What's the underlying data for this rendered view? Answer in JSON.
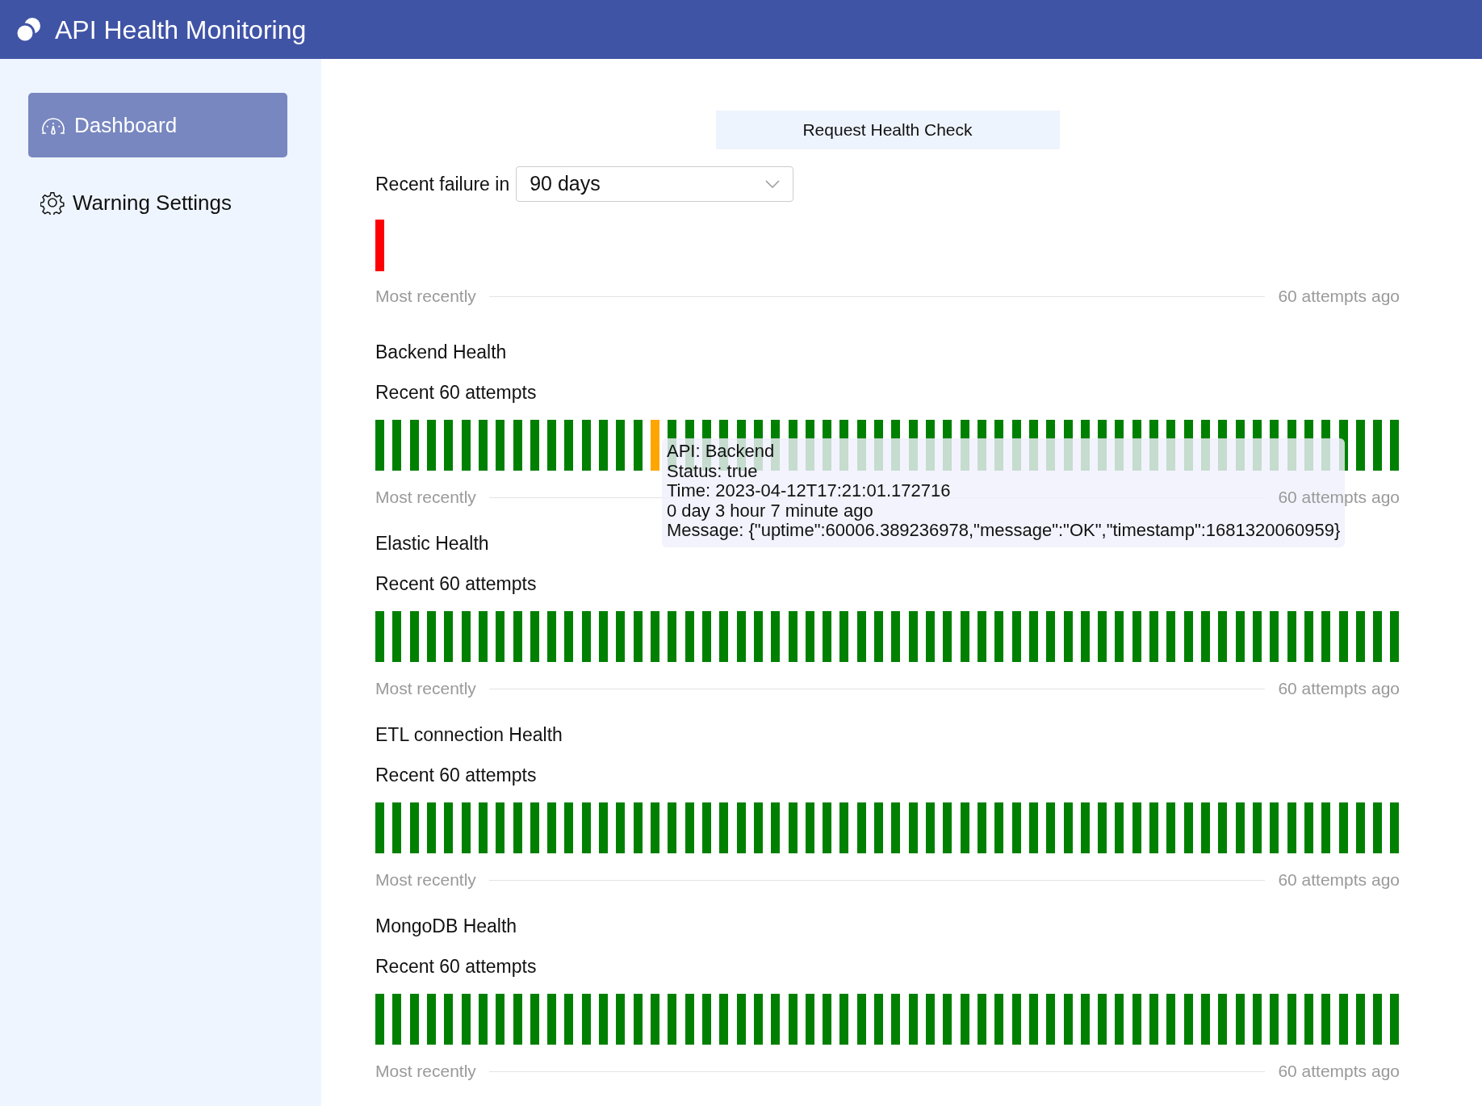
{
  "app": {
    "title": "API Health Monitoring"
  },
  "sidebar": {
    "items": [
      {
        "label": "Dashboard",
        "selected": true
      },
      {
        "label": "Warning Settings",
        "selected": false
      }
    ]
  },
  "toolbar": {
    "button": "Request Health Check"
  },
  "failure_filter": {
    "label": "Recent failure in",
    "value": "90 days"
  },
  "recent_failures": {
    "attempts": [
      {
        "color": "#ff0000"
      }
    ],
    "axis_start": "Most recently",
    "axis_end": "60 attempts ago"
  },
  "sections": [
    {
      "title": "Backend Health",
      "subtitle": "Recent 60 attempts",
      "attempts": [
        {
          "color": "#008000"
        },
        {
          "color": "#008000"
        },
        {
          "color": "#008000"
        },
        {
          "color": "#008000"
        },
        {
          "color": "#008000"
        },
        {
          "color": "#008000"
        },
        {
          "color": "#008000"
        },
        {
          "color": "#008000"
        },
        {
          "color": "#008000"
        },
        {
          "color": "#008000"
        },
        {
          "color": "#008000"
        },
        {
          "color": "#008000"
        },
        {
          "color": "#008000"
        },
        {
          "color": "#008000"
        },
        {
          "color": "#008000"
        },
        {
          "color": "#008000"
        },
        {
          "color": "#ffa500"
        },
        {
          "color": "#008000"
        },
        {
          "color": "#008000"
        },
        {
          "color": "#008000"
        },
        {
          "color": "#008000"
        },
        {
          "color": "#008000"
        },
        {
          "color": "#008000"
        },
        {
          "color": "#008000"
        },
        {
          "color": "#008000"
        },
        {
          "color": "#008000"
        },
        {
          "color": "#008000"
        },
        {
          "color": "#008000"
        },
        {
          "color": "#008000"
        },
        {
          "color": "#008000"
        },
        {
          "color": "#008000"
        },
        {
          "color": "#008000"
        },
        {
          "color": "#008000"
        },
        {
          "color": "#008000"
        },
        {
          "color": "#008000"
        },
        {
          "color": "#008000"
        },
        {
          "color": "#008000"
        },
        {
          "color": "#008000"
        },
        {
          "color": "#008000"
        },
        {
          "color": "#008000"
        },
        {
          "color": "#008000"
        },
        {
          "color": "#008000"
        },
        {
          "color": "#008000"
        },
        {
          "color": "#008000"
        },
        {
          "color": "#008000"
        },
        {
          "color": "#008000"
        },
        {
          "color": "#008000"
        },
        {
          "color": "#008000"
        },
        {
          "color": "#008000"
        },
        {
          "color": "#008000"
        },
        {
          "color": "#008000"
        },
        {
          "color": "#008000"
        },
        {
          "color": "#008000"
        },
        {
          "color": "#008000"
        },
        {
          "color": "#008000"
        },
        {
          "color": "#008000"
        },
        {
          "color": "#008000"
        },
        {
          "color": "#008000"
        },
        {
          "color": "#008000"
        },
        {
          "color": "#008000"
        }
      ],
      "axis_start": "Most recently",
      "axis_end": "60 attempts ago",
      "tooltip": {
        "lines": [
          "API: Backend",
          "Status: true",
          "Time: 2023-04-12T17:21:01.172716",
          "0 day 3 hour 7 minute ago",
          "Message: {\"uptime\":60006.389236978,\"message\":\"OK\",\"timestamp\":1681320060959}"
        ]
      }
    },
    {
      "title": "Elastic Health",
      "subtitle": "Recent 60 attempts",
      "attempts": [
        {
          "color": "#008000"
        },
        {
          "color": "#008000"
        },
        {
          "color": "#008000"
        },
        {
          "color": "#008000"
        },
        {
          "color": "#008000"
        },
        {
          "color": "#008000"
        },
        {
          "color": "#008000"
        },
        {
          "color": "#008000"
        },
        {
          "color": "#008000"
        },
        {
          "color": "#008000"
        },
        {
          "color": "#008000"
        },
        {
          "color": "#008000"
        },
        {
          "color": "#008000"
        },
        {
          "color": "#008000"
        },
        {
          "color": "#008000"
        },
        {
          "color": "#008000"
        },
        {
          "color": "#008000"
        },
        {
          "color": "#008000"
        },
        {
          "color": "#008000"
        },
        {
          "color": "#008000"
        },
        {
          "color": "#008000"
        },
        {
          "color": "#008000"
        },
        {
          "color": "#008000"
        },
        {
          "color": "#008000"
        },
        {
          "color": "#008000"
        },
        {
          "color": "#008000"
        },
        {
          "color": "#008000"
        },
        {
          "color": "#008000"
        },
        {
          "color": "#008000"
        },
        {
          "color": "#008000"
        },
        {
          "color": "#008000"
        },
        {
          "color": "#008000"
        },
        {
          "color": "#008000"
        },
        {
          "color": "#008000"
        },
        {
          "color": "#008000"
        },
        {
          "color": "#008000"
        },
        {
          "color": "#008000"
        },
        {
          "color": "#008000"
        },
        {
          "color": "#008000"
        },
        {
          "color": "#008000"
        },
        {
          "color": "#008000"
        },
        {
          "color": "#008000"
        },
        {
          "color": "#008000"
        },
        {
          "color": "#008000"
        },
        {
          "color": "#008000"
        },
        {
          "color": "#008000"
        },
        {
          "color": "#008000"
        },
        {
          "color": "#008000"
        },
        {
          "color": "#008000"
        },
        {
          "color": "#008000"
        },
        {
          "color": "#008000"
        },
        {
          "color": "#008000"
        },
        {
          "color": "#008000"
        },
        {
          "color": "#008000"
        },
        {
          "color": "#008000"
        },
        {
          "color": "#008000"
        },
        {
          "color": "#008000"
        },
        {
          "color": "#008000"
        },
        {
          "color": "#008000"
        },
        {
          "color": "#008000"
        }
      ],
      "axis_start": "Most recently",
      "axis_end": "60 attempts ago"
    },
    {
      "title": "ETL connection Health",
      "subtitle": "Recent 60 attempts",
      "attempts": [
        {
          "color": "#008000"
        },
        {
          "color": "#008000"
        },
        {
          "color": "#008000"
        },
        {
          "color": "#008000"
        },
        {
          "color": "#008000"
        },
        {
          "color": "#008000"
        },
        {
          "color": "#008000"
        },
        {
          "color": "#008000"
        },
        {
          "color": "#008000"
        },
        {
          "color": "#008000"
        },
        {
          "color": "#008000"
        },
        {
          "color": "#008000"
        },
        {
          "color": "#008000"
        },
        {
          "color": "#008000"
        },
        {
          "color": "#008000"
        },
        {
          "color": "#008000"
        },
        {
          "color": "#008000"
        },
        {
          "color": "#008000"
        },
        {
          "color": "#008000"
        },
        {
          "color": "#008000"
        },
        {
          "color": "#008000"
        },
        {
          "color": "#008000"
        },
        {
          "color": "#008000"
        },
        {
          "color": "#008000"
        },
        {
          "color": "#008000"
        },
        {
          "color": "#008000"
        },
        {
          "color": "#008000"
        },
        {
          "color": "#008000"
        },
        {
          "color": "#008000"
        },
        {
          "color": "#008000"
        },
        {
          "color": "#008000"
        },
        {
          "color": "#008000"
        },
        {
          "color": "#008000"
        },
        {
          "color": "#008000"
        },
        {
          "color": "#008000"
        },
        {
          "color": "#008000"
        },
        {
          "color": "#008000"
        },
        {
          "color": "#008000"
        },
        {
          "color": "#008000"
        },
        {
          "color": "#008000"
        },
        {
          "color": "#008000"
        },
        {
          "color": "#008000"
        },
        {
          "color": "#008000"
        },
        {
          "color": "#008000"
        },
        {
          "color": "#008000"
        },
        {
          "color": "#008000"
        },
        {
          "color": "#008000"
        },
        {
          "color": "#008000"
        },
        {
          "color": "#008000"
        },
        {
          "color": "#008000"
        },
        {
          "color": "#008000"
        },
        {
          "color": "#008000"
        },
        {
          "color": "#008000"
        },
        {
          "color": "#008000"
        },
        {
          "color": "#008000"
        },
        {
          "color": "#008000"
        },
        {
          "color": "#008000"
        },
        {
          "color": "#008000"
        },
        {
          "color": "#008000"
        },
        {
          "color": "#008000"
        }
      ],
      "axis_start": "Most recently",
      "axis_end": "60 attempts ago"
    },
    {
      "title": "MongoDB Health",
      "subtitle": "Recent 60 attempts",
      "attempts": [
        {
          "color": "#008000"
        },
        {
          "color": "#008000"
        },
        {
          "color": "#008000"
        },
        {
          "color": "#008000"
        },
        {
          "color": "#008000"
        },
        {
          "color": "#008000"
        },
        {
          "color": "#008000"
        },
        {
          "color": "#008000"
        },
        {
          "color": "#008000"
        },
        {
          "color": "#008000"
        },
        {
          "color": "#008000"
        },
        {
          "color": "#008000"
        },
        {
          "color": "#008000"
        },
        {
          "color": "#008000"
        },
        {
          "color": "#008000"
        },
        {
          "color": "#008000"
        },
        {
          "color": "#008000"
        },
        {
          "color": "#008000"
        },
        {
          "color": "#008000"
        },
        {
          "color": "#008000"
        },
        {
          "color": "#008000"
        },
        {
          "color": "#008000"
        },
        {
          "color": "#008000"
        },
        {
          "color": "#008000"
        },
        {
          "color": "#008000"
        },
        {
          "color": "#008000"
        },
        {
          "color": "#008000"
        },
        {
          "color": "#008000"
        },
        {
          "color": "#008000"
        },
        {
          "color": "#008000"
        },
        {
          "color": "#008000"
        },
        {
          "color": "#008000"
        },
        {
          "color": "#008000"
        },
        {
          "color": "#008000"
        },
        {
          "color": "#008000"
        },
        {
          "color": "#008000"
        },
        {
          "color": "#008000"
        },
        {
          "color": "#008000"
        },
        {
          "color": "#008000"
        },
        {
          "color": "#008000"
        },
        {
          "color": "#008000"
        },
        {
          "color": "#008000"
        },
        {
          "color": "#008000"
        },
        {
          "color": "#008000"
        },
        {
          "color": "#008000"
        },
        {
          "color": "#008000"
        },
        {
          "color": "#008000"
        },
        {
          "color": "#008000"
        },
        {
          "color": "#008000"
        },
        {
          "color": "#008000"
        },
        {
          "color": "#008000"
        },
        {
          "color": "#008000"
        },
        {
          "color": "#008000"
        },
        {
          "color": "#008000"
        },
        {
          "color": "#008000"
        },
        {
          "color": "#008000"
        },
        {
          "color": "#008000"
        },
        {
          "color": "#008000"
        },
        {
          "color": "#008000"
        },
        {
          "color": "#008000"
        }
      ],
      "axis_start": "Most recently",
      "axis_end": "60 attempts ago"
    }
  ]
}
